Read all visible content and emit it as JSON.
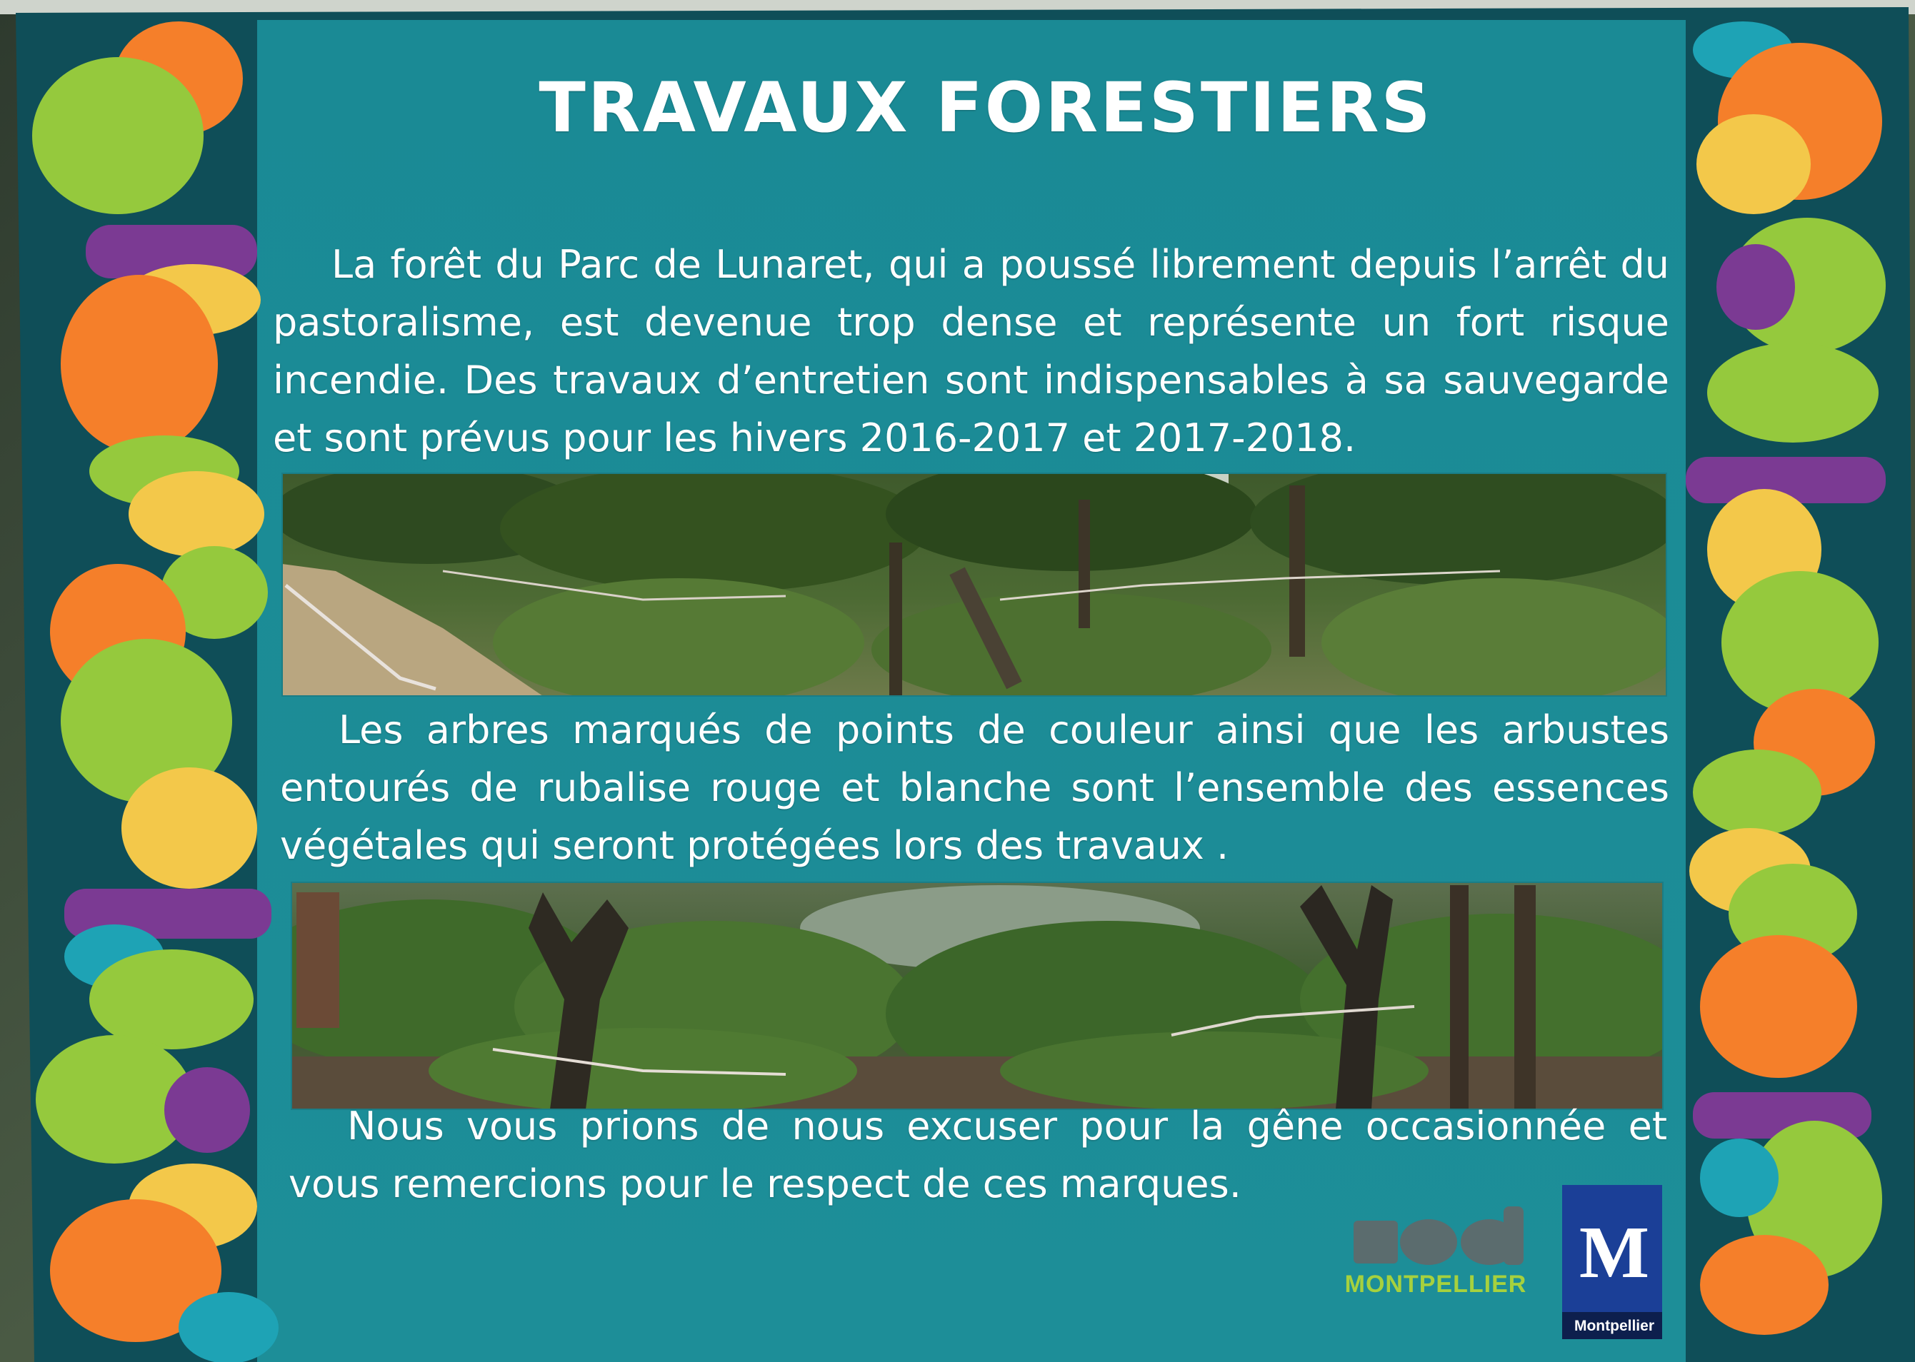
{
  "sign": {
    "title": "TRAVAUX FORESTIERS",
    "paragraph_1": "La forêt du Parc de Lunaret, qui a poussé librement depuis l’arrêt du pastoralisme, est devenue trop dense et représente un fort risque incendie. Des travaux d’entretien sont indispensables à sa sauvegarde et sont prévus pour les hivers 2016-2017 et 2017-2018.",
    "paragraph_2": "Les arbres marqués de points de couleur ainsi que les arbustes entourés de rubalise rouge et blanche sont l’ensemble des essences végétales qui seront protégées lors des travaux .",
    "paragraph_3": "Nous vous prions de nous excuser pour la gêne occasionnée et vous remercions pour le respect de ces marques."
  },
  "logos": {
    "zoo_name": "MONTPELLIER",
    "metropole_letter": "M",
    "metropole_name": "Montpellier"
  },
  "colors": {
    "panel_teal": "#1d8f98",
    "border_dark_teal": "#0f4e58",
    "tree_orange": "#f57f2a",
    "tree_green": "#95c93d",
    "tree_yellow": "#f3c84a",
    "tree_purple": "#7b3a93",
    "tree_blue": "#1ea3b5",
    "zoo_green": "#a6d13e",
    "metropole_blue": "#1b3f97"
  }
}
